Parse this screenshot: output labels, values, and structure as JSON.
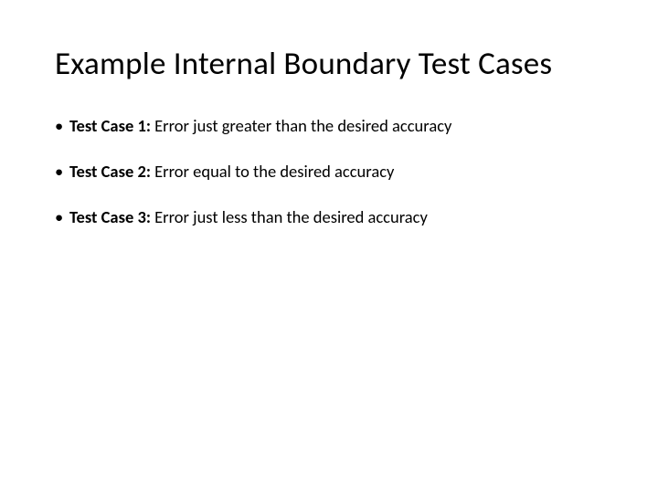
{
  "title": "Example Internal Boundary Test Cases",
  "items": [
    {
      "label": "Test Case 1:",
      "desc": " Error just greater than the desired accuracy"
    },
    {
      "label": "Test Case 2:",
      "desc": " Error equal to the desired accuracy"
    },
    {
      "label": "Test Case 3:",
      "desc": " Error just less than the desired accuracy"
    }
  ]
}
